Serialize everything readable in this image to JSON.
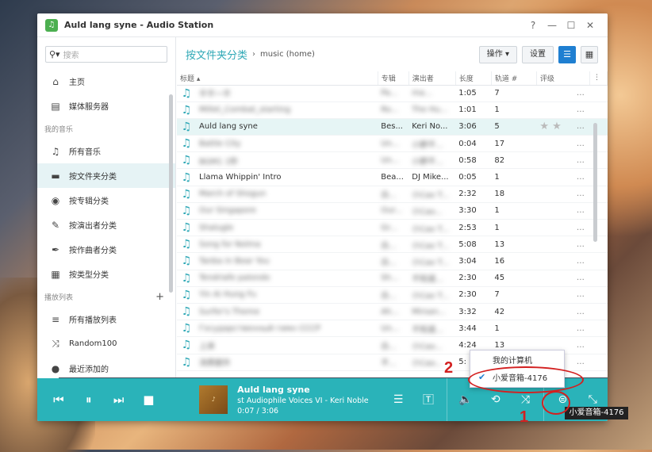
{
  "window": {
    "title": "Auld lang syne - Audio Station",
    "app_icon": "music-note-icon"
  },
  "titlebar": {
    "help": "?",
    "minimize": "—",
    "maximize": "☐",
    "close": "✕"
  },
  "sidebar": {
    "search_placeholder": "搜索",
    "top_items": [
      {
        "label": "主页"
      },
      {
        "label": "媒体服务器"
      }
    ],
    "music_section": "我的音乐",
    "music_items": [
      {
        "label": "所有音乐"
      },
      {
        "label": "按文件夹分类"
      },
      {
        "label": "按专辑分类"
      },
      {
        "label": "按演出者分类"
      },
      {
        "label": "按作曲者分类"
      },
      {
        "label": "按类型分类"
      }
    ],
    "playlist_section": "播放列表",
    "playlist_items": [
      {
        "label": "所有播放列表"
      },
      {
        "label": "Random100"
      },
      {
        "label": "最近添加的"
      }
    ]
  },
  "main": {
    "breadcrumb_main": "按文件夹分类",
    "breadcrumb_sep": "›",
    "breadcrumb_sub": "music (home)",
    "action_button": "操作 ▾",
    "settings_button": "设置",
    "columns": [
      "标题 ▴",
      "专辑",
      "演出者",
      "长度",
      "轨道 #",
      "评级"
    ],
    "rows": [
      {
        "title": "不不一不",
        "album": "Pa...",
        "artist": "ma...",
        "length": "1:05",
        "track": "7",
        "blur": true
      },
      {
        "title": "Millet_Combat_starting",
        "album": "Ro...",
        "artist": "The Hu...",
        "length": "1:01",
        "track": "1",
        "blur": true
      },
      {
        "title": "Auld lang syne",
        "album": "Bes...",
        "artist": "Keri No...",
        "length": "3:06",
        "track": "5",
        "blur": false,
        "playing": true
      },
      {
        "title": "Battle City",
        "album": "Un...",
        "artist": "小野不...",
        "length": "0:04",
        "track": "17",
        "blur": true
      },
      {
        "title": "BGM1 1秒",
        "album": "Un...",
        "artist": "小野不...",
        "length": "0:58",
        "track": "82",
        "blur": true
      },
      {
        "title": "Llama Whippin' Intro",
        "album": "Bea...",
        "artist": "DJ Mike...",
        "length": "0:05",
        "track": "1",
        "blur": false
      },
      {
        "title": "March of Shogun",
        "album": "白...",
        "artist": "小Cao T...",
        "length": "2:32",
        "track": "18",
        "blur": true
      },
      {
        "title": "Our Singapore",
        "album": "Our...",
        "artist": "小Cao...",
        "length": "3:30",
        "track": "1",
        "blur": true
      },
      {
        "title": "Shalugle",
        "album": "Gr...",
        "artist": "小Cao T...",
        "length": "2:53",
        "track": "1",
        "blur": true
      },
      {
        "title": "Song for Nolma",
        "album": "白...",
        "artist": "小Cao T...",
        "length": "5:08",
        "track": "13",
        "blur": true
      },
      {
        "title": "Tanba in Bear You",
        "album": "白...",
        "artist": "小Cao T...",
        "length": "3:04",
        "track": "16",
        "blur": true
      },
      {
        "title": "Tendriafe palondo",
        "album": "Sh...",
        "artist": "不知道...",
        "length": "2:30",
        "track": "45",
        "blur": true
      },
      {
        "title": "Yin Ai Hung Fu",
        "album": "白...",
        "artist": "小Cao T...",
        "length": "2:30",
        "track": "7",
        "blur": true
      },
      {
        "title": "Surfer's Theme",
        "album": "Ah...",
        "artist": "Mirsan...",
        "length": "3:32",
        "track": "42",
        "blur": true
      },
      {
        "title": "Государственный гимн СССР",
        "album": "Un...",
        "artist": "不知道...",
        "length": "3:44",
        "track": "1",
        "blur": true
      },
      {
        "title": "上床",
        "album": "白...",
        "artist": "小Cao...",
        "length": "4:24",
        "track": "13",
        "blur": true
      },
      {
        "title": "消费额外",
        "album": "不...",
        "artist": "小Cao...",
        "length": "5:",
        "track": "",
        "blur": true
      }
    ]
  },
  "player": {
    "title": "Auld lang syne",
    "subtitle": "st Audiophile Voices VI - Keri Noble",
    "time": "0:07 / 3:06",
    "progress_fraction": 0.037
  },
  "renderer_menu": {
    "items": [
      {
        "label": "我的计算机",
        "checked": false
      },
      {
        "label": "小爱音箱-4176",
        "checked": true
      }
    ]
  },
  "tooltip": "小爱音箱-4176",
  "annotations": {
    "one": "1",
    "two": "2"
  },
  "colors": {
    "accent": "#2ab3b9",
    "annotation": "#d32020",
    "primary_button": "#1f7fd1"
  }
}
